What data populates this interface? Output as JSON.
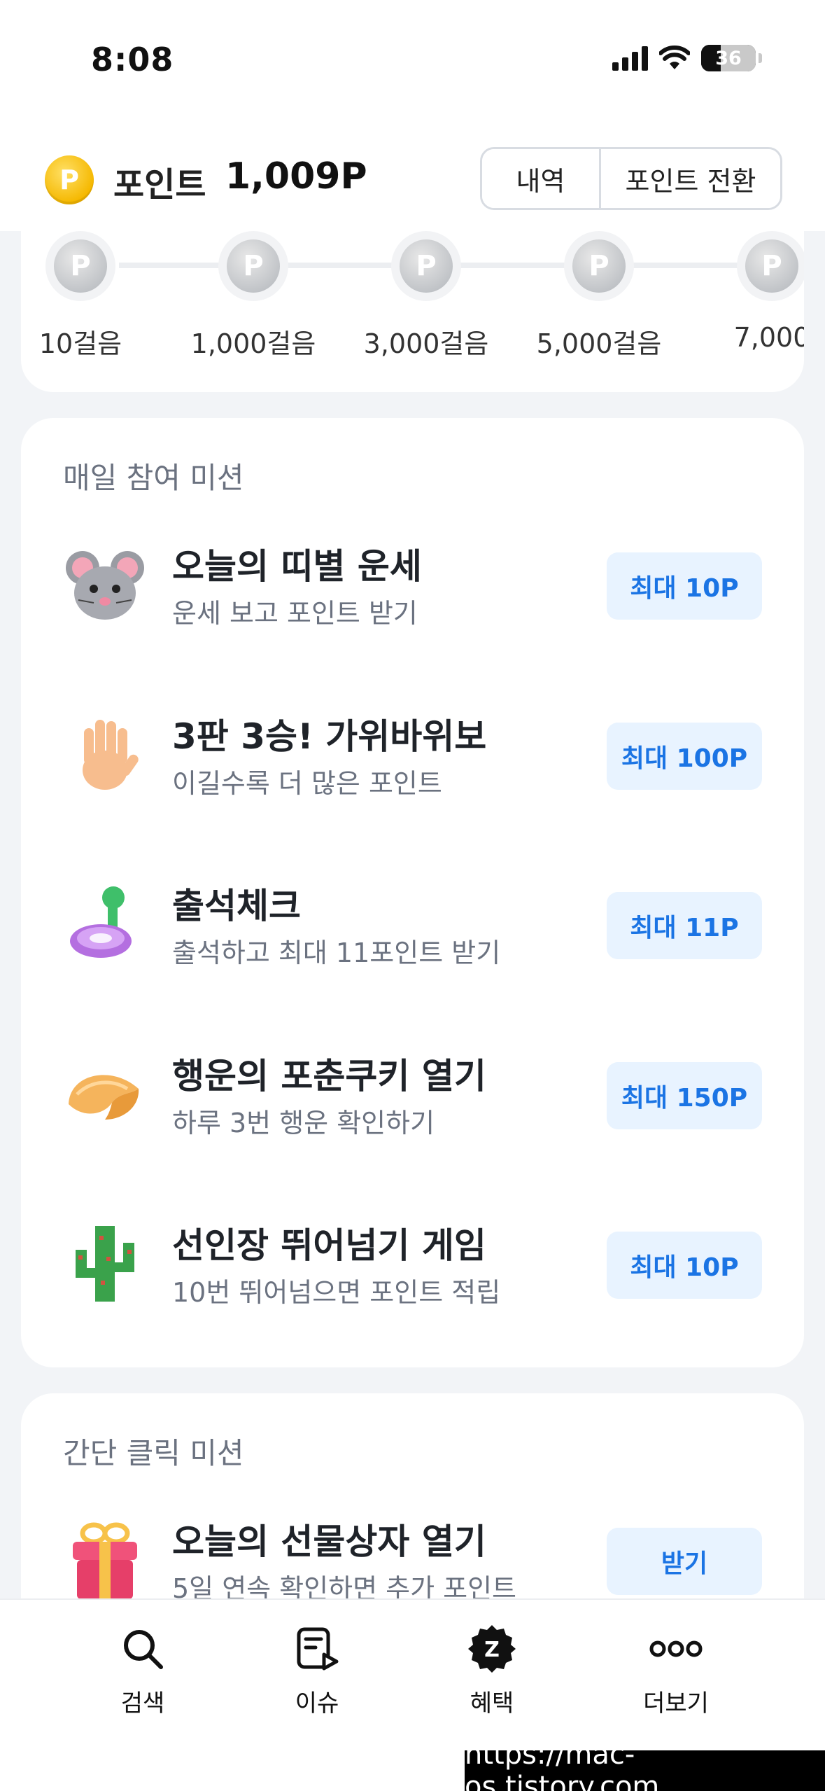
{
  "status_bar": {
    "time": "8:08",
    "battery": "36"
  },
  "header": {
    "coin_symbol": "P",
    "points_label": "포인트",
    "points_value": "1,009P",
    "history_button": "내역",
    "convert_button": "포인트 전환"
  },
  "steps": {
    "items": [
      {
        "label": "10걸음",
        "coin_symbol": "P"
      },
      {
        "label": "1,000걸음",
        "coin_symbol": "P"
      },
      {
        "label": "3,000걸음",
        "coin_symbol": "P"
      },
      {
        "label": "5,000걸음",
        "coin_symbol": "P"
      },
      {
        "label": "7,000",
        "coin_symbol": "P"
      }
    ]
  },
  "daily_missions": {
    "title": "매일 참여 미션",
    "items": [
      {
        "title": "오늘의 띠별 운세",
        "subtitle": "운세 보고 포인트 받기",
        "button": "최대 10P",
        "icon": "mouse-icon"
      },
      {
        "title": "3판 3승! 가위바위보",
        "subtitle": "이길수록 더 많은 포인트",
        "button": "최대 100P",
        "icon": "hand-icon"
      },
      {
        "title": "출석체크",
        "subtitle": "출석하고 최대 11포인트 받기",
        "button": "최대 11P",
        "icon": "stamp-icon"
      },
      {
        "title": "행운의 포춘쿠키 열기",
        "subtitle": "하루 3번 행운 확인하기",
        "button": "최대 150P",
        "icon": "fortune-cookie-icon"
      },
      {
        "title": "선인장 뛰어넘기 게임",
        "subtitle": "10번 뛰어넘으면 포인트 적립",
        "button": "최대 10P",
        "icon": "cactus-icon"
      }
    ]
  },
  "click_missions": {
    "title": "간단 클릭 미션",
    "items": [
      {
        "title": "오늘의 선물상자 열기",
        "subtitle": "5일 연속 확인하면 추가 포인트",
        "button": "받기",
        "icon": "gift-icon"
      }
    ]
  },
  "bottom_nav": {
    "items": [
      {
        "label": "검색",
        "icon": "search-icon"
      },
      {
        "label": "이슈",
        "icon": "issue-icon"
      },
      {
        "label": "혜택",
        "icon": "benefit-icon",
        "icon_letter": "Z"
      },
      {
        "label": "더보기",
        "icon": "more-icon"
      }
    ]
  },
  "watermark": "https://mac-os.tistory.com",
  "colors": {
    "accent_blue": "#1b74e4",
    "button_bg": "#e8f3ff",
    "coin_gold": "#f5b800",
    "page_bg": "#f2f4f7"
  }
}
